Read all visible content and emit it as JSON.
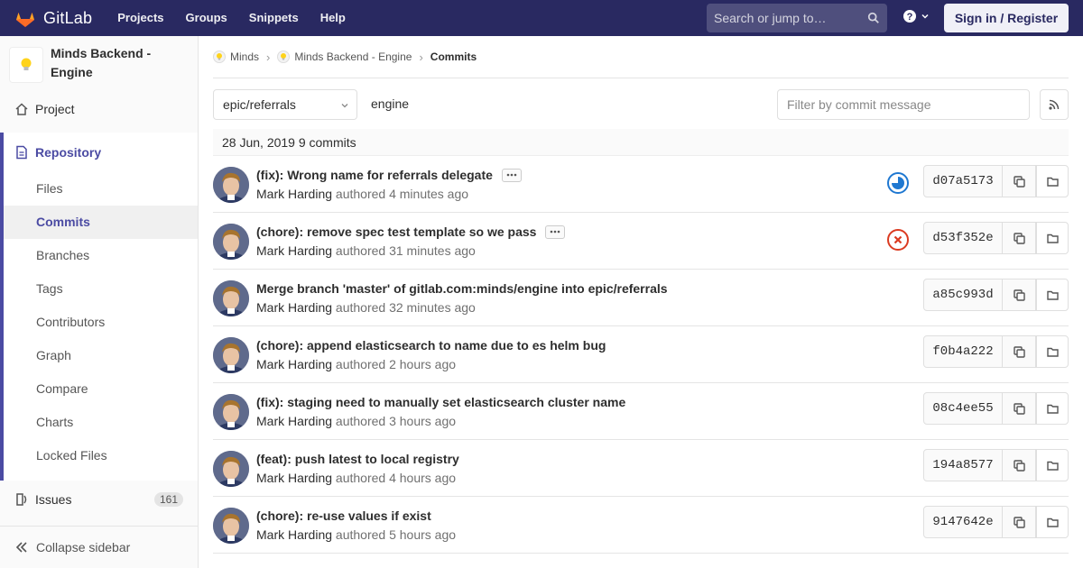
{
  "navbar": {
    "brand": "GitLab",
    "links": [
      "Projects",
      "Groups",
      "Snippets",
      "Help"
    ],
    "search_placeholder": "Search or jump to…",
    "signin": "Sign in / Register",
    "brand_color": "#292961"
  },
  "sidebar": {
    "project_title": "Minds Backend - Engine",
    "project_link": "Project",
    "repository": "Repository",
    "sub_items": [
      "Files",
      "Commits",
      "Branches",
      "Tags",
      "Contributors",
      "Graph",
      "Compare",
      "Charts",
      "Locked Files"
    ],
    "active_sub_item": "Commits",
    "issues_label": "Issues",
    "issues_count": "161",
    "collapse": "Collapse sidebar",
    "accent_color": "#4b4ba3"
  },
  "breadcrumb": {
    "items": [
      "Minds",
      "Minds Backend - Engine"
    ],
    "current": "Commits"
  },
  "toolbar": {
    "branch": "epic/referrals",
    "path": "engine",
    "filter_placeholder": "Filter by commit message"
  },
  "day_header": "28 Jun, 2019 9 commits",
  "commits": [
    {
      "title": "(fix): Wrong name for referrals delegate",
      "author": "Mark Harding",
      "verb": "authored",
      "time": "4 minutes ago",
      "sha": "d07a5173",
      "status": "running",
      "has_more": true
    },
    {
      "title": "(chore): remove spec test template so we pass",
      "author": "Mark Harding",
      "verb": "authored",
      "time": "31 minutes ago",
      "sha": "d53f352e",
      "status": "failed",
      "has_more": true
    },
    {
      "title": "Merge branch 'master' of gitlab.com:minds/engine into epic/referrals",
      "author": "Mark Harding",
      "verb": "authored",
      "time": "32 minutes ago",
      "sha": "a85c993d",
      "status": "none",
      "has_more": false
    },
    {
      "title": "(chore): append elasticsearch to name due to es helm bug",
      "author": "Mark Harding",
      "verb": "authored",
      "time": "2 hours ago",
      "sha": "f0b4a222",
      "status": "none",
      "has_more": false
    },
    {
      "title": "(fix): staging need to manually set elasticsearch cluster name",
      "author": "Mark Harding",
      "verb": "authored",
      "time": "3 hours ago",
      "sha": "08c4ee55",
      "status": "none",
      "has_more": false
    },
    {
      "title": "(feat): push latest to local registry",
      "author": "Mark Harding",
      "verb": "authored",
      "time": "4 hours ago",
      "sha": "194a8577",
      "status": "none",
      "has_more": false
    },
    {
      "title": "(chore): re-use values if exist",
      "author": "Mark Harding",
      "verb": "authored",
      "time": "5 hours ago",
      "sha": "9147642e",
      "status": "none",
      "has_more": false
    }
  ]
}
